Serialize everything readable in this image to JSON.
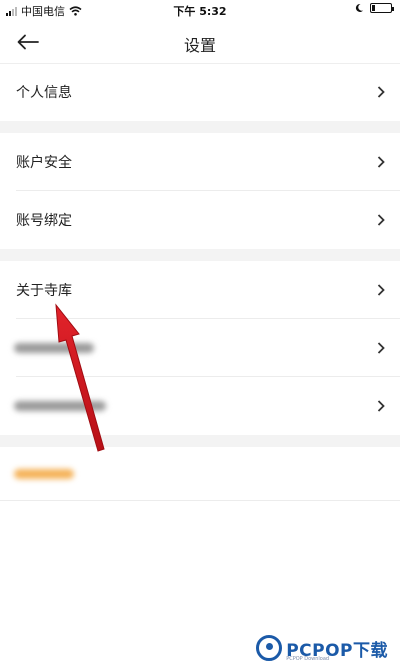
{
  "status_bar": {
    "carrier": "中国电信",
    "time": "下午 5:32"
  },
  "nav": {
    "title": "设置"
  },
  "rows": [
    {
      "label": "个人信息"
    },
    {
      "label": "账户安全"
    },
    {
      "label": "账号绑定"
    },
    {
      "label": "关于寺库"
    }
  ],
  "watermark": {
    "text": "PCPOP下载",
    "sub": "PCPOP Download"
  },
  "colors": {
    "gap": "#f3f3f3",
    "arrow": "#d5141c",
    "blurred_link": "#f5b35a"
  }
}
